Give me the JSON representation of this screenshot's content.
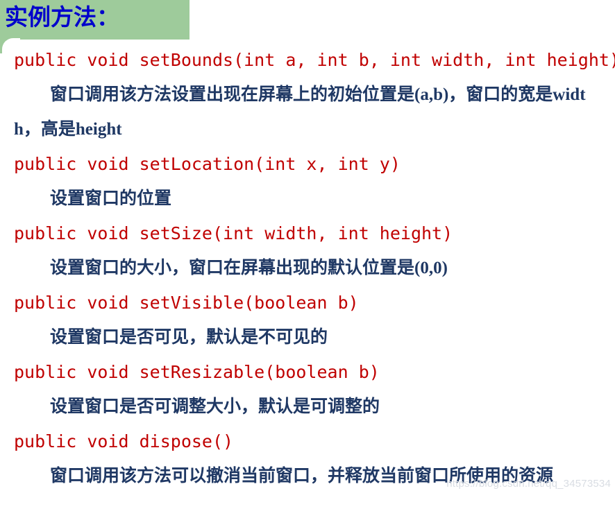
{
  "slide": {
    "title": "实例方法：",
    "title_color": "#0000CC",
    "banner_color": "#9ECB9B",
    "signature_color": "#C00000",
    "description_color": "#1F3864",
    "background_color": "#FFFFFF"
  },
  "methods": [
    {
      "signature": "public void setBounds(int a, int b, int width, int height)",
      "description": "窗口调用该方法设置出现在屏幕上的初始位置是(a,b)，窗口的宽是width，高是height"
    },
    {
      "signature": "public void setLocation(int x, int y)",
      "description": "设置窗口的位置"
    },
    {
      "signature": "public void setSize(int width, int height)",
      "description": "设置窗口的大小，窗口在屏幕出现的默认位置是(0,0)"
    },
    {
      "signature": "public void setVisible(boolean b)",
      "description": "设置窗口是否可见，默认是不可见的"
    },
    {
      "signature": "public void setResizable(boolean b)",
      "description": "设置窗口是否可调整大小，默认是可调整的"
    },
    {
      "signature": "public void dispose()",
      "description": "窗口调用该方法可以撤消当前窗口，并释放当前窗口所使用的资源"
    }
  ],
  "watermark": {
    "text": "https://blog.csdn.net/qq_34573534"
  }
}
